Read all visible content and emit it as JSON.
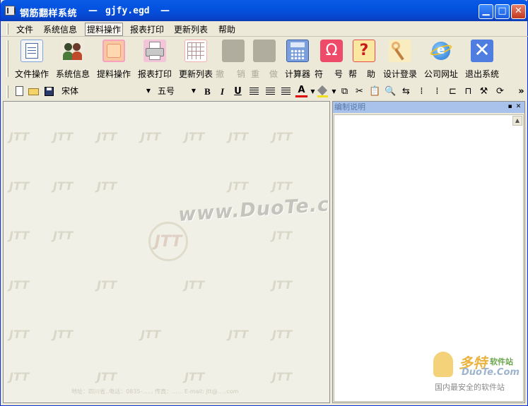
{
  "window": {
    "title": "钢筋翻样系统",
    "sep": "—",
    "filename": "gjfy.egd",
    "sep2": "—",
    "min_label": "▁",
    "max_label": "□",
    "close_label": "✕"
  },
  "menu": [
    {
      "label": "文件"
    },
    {
      "label": "系统信息"
    },
    {
      "label": "提料操作"
    },
    {
      "label": "报表打印"
    },
    {
      "label": "更新列表"
    },
    {
      "label": "帮助"
    }
  ],
  "big_toolbar": [
    {
      "label": "文件操作",
      "icon": "file-op-icon",
      "color": "#7ea6dd"
    },
    {
      "label": "系统信息",
      "icon": "users-icon",
      "color": "#4b5a3c"
    },
    {
      "label": "提料操作",
      "icon": "material-icon",
      "color": "#f7a9a0"
    },
    {
      "label": "报表打印",
      "icon": "printer-icon",
      "color": "#c8c8c8"
    },
    {
      "label": "更新列表",
      "icon": "table-icon",
      "color": "#f4b0b0"
    },
    {
      "label": "撤",
      "icon": "undo-icon",
      "color": "#aca899"
    },
    {
      "label": "销",
      "icon": "",
      "color": ""
    },
    {
      "label": "重",
      "icon": "redo-icon",
      "color": "#aca899"
    },
    {
      "label": "做",
      "icon": "",
      "color": ""
    },
    {
      "label": "计算器",
      "icon": "calculator-icon",
      "color": "#7a9fdc"
    },
    {
      "label": "符",
      "icon": "omega-icon",
      "color": "#ee4a6a"
    },
    {
      "label": "号",
      "icon": "",
      "color": ""
    },
    {
      "label": "帮",
      "icon": "help-icon",
      "color": "#e84b4b"
    },
    {
      "label": "助",
      "icon": "",
      "color": ""
    },
    {
      "label": "设计登录",
      "icon": "key-icon",
      "color": "#e8b06a"
    },
    {
      "label": "公司网址",
      "icon": "ie-icon",
      "color": "#3b8ad8"
    },
    {
      "label": "退出系统",
      "icon": "exit-icon",
      "color": "#4f7ee0"
    }
  ],
  "format_toolbar": {
    "font_name": "宋体",
    "font_size": "五号",
    "bold": "B",
    "italic": "I",
    "underline": "U",
    "font_color": "A",
    "overflow": "»"
  },
  "right_pane": {
    "title": "编制说明",
    "pin": "▪",
    "close": "✕"
  },
  "watermark": {
    "url": "www.DuoTe.com",
    "logo": "JTT",
    "footer": "地址：四川省..电话：0835-...... 传真：...... E-mail: jtt@.....com"
  },
  "badge": {
    "brand": "多特",
    "brand_suffix": "软件站",
    "domain": "DuoTe.Com",
    "slogan": "国内最安全的软件站"
  }
}
